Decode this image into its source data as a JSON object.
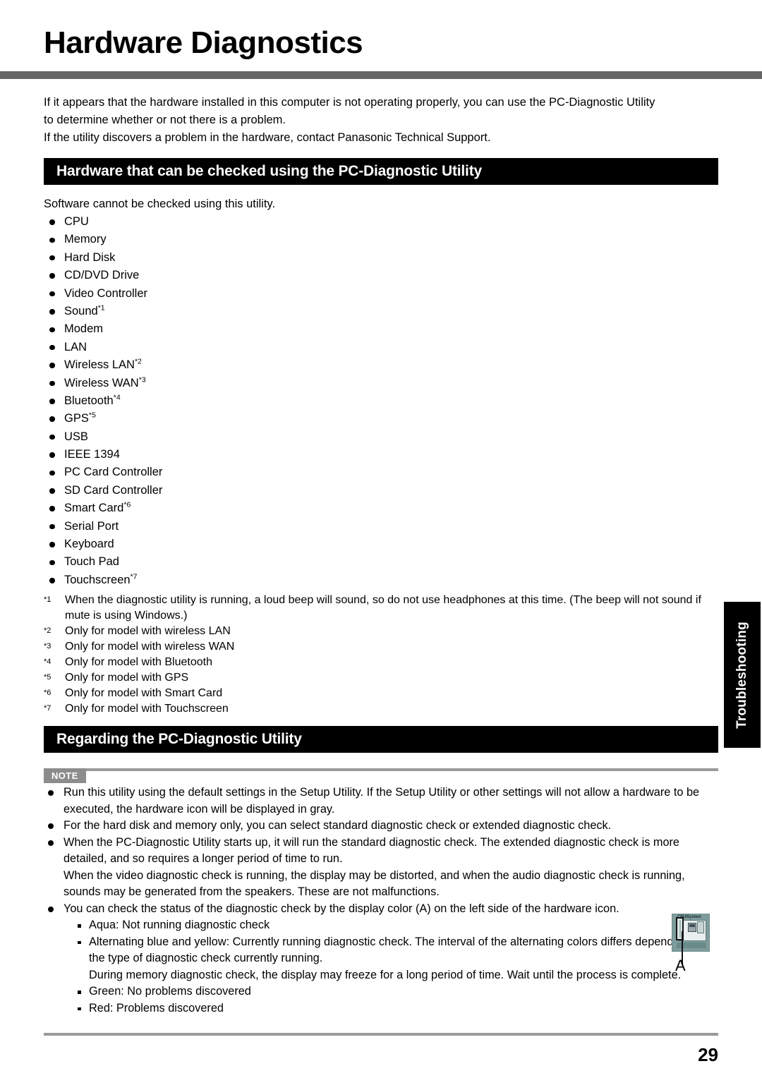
{
  "document": {
    "title": "Hardware Diagnostics",
    "page_number": "29",
    "side_tab_label": "Troubleshooting"
  },
  "intro": {
    "line1": "If it appears that the hardware installed in this computer is not operating properly, you can use the PC-Diagnostic Utility",
    "line2": "to determine whether or not there is a problem.",
    "line3": "If the utility discovers a problem in the hardware, contact Panasonic Technical Support."
  },
  "sections": {
    "hardware_checked": {
      "heading": "Hardware that can be checked using the PC-Diagnostic Utility",
      "lead": "Software cannot be checked using this utility.",
      "items": [
        {
          "label": "CPU",
          "footnote": ""
        },
        {
          "label": "Memory",
          "footnote": ""
        },
        {
          "label": "Hard Disk",
          "footnote": ""
        },
        {
          "label": "CD/DVD Drive",
          "footnote": ""
        },
        {
          "label": "Video Controller",
          "footnote": ""
        },
        {
          "label": "Sound",
          "footnote": "*1"
        },
        {
          "label": "Modem",
          "footnote": ""
        },
        {
          "label": "LAN",
          "footnote": ""
        },
        {
          "label": "Wireless LAN",
          "footnote": "*2"
        },
        {
          "label": "Wireless WAN",
          "footnote": "*3"
        },
        {
          "label": "Bluetooth",
          "footnote": "*4"
        },
        {
          "label": "GPS",
          "footnote": "*5"
        },
        {
          "label": "USB",
          "footnote": ""
        },
        {
          "label": "IEEE 1394",
          "footnote": ""
        },
        {
          "label": "PC Card Controller",
          "footnote": ""
        },
        {
          "label": "SD Card Controller",
          "footnote": ""
        },
        {
          "label": "Smart Card",
          "footnote": "*6"
        },
        {
          "label": "Serial Port",
          "footnote": ""
        },
        {
          "label": "Keyboard",
          "footnote": ""
        },
        {
          "label": "Touch Pad",
          "footnote": ""
        },
        {
          "label": "Touchscreen",
          "footnote": "*7"
        }
      ],
      "footnotes": [
        {
          "marker": "*1",
          "text": "When the diagnostic utility is running, a loud beep will sound, so do not use headphones at this time. (The beep will not sound if mute is using Windows.)"
        },
        {
          "marker": "*2",
          "text": "Only for model with wireless LAN"
        },
        {
          "marker": "*3",
          "text": "Only for model with wireless WAN"
        },
        {
          "marker": "*4",
          "text": "Only for model with Bluetooth"
        },
        {
          "marker": "*5",
          "text": "Only for model with GPS"
        },
        {
          "marker": "*6",
          "text": "Only for model with Smart Card"
        },
        {
          "marker": "*7",
          "text": "Only for model with Touchscreen"
        }
      ]
    },
    "regarding_utility": {
      "heading": "Regarding the PC-Diagnostic Utility",
      "note_badge": "NOTE",
      "note_items": {
        "b1": "Run this utility using the default settings in the Setup Utility. If the Setup Utility or other settings will not allow a hardware to be executed, the hardware icon will be displayed in gray.",
        "b2": "For the hard disk and memory only, you can select standard diagnostic check or extended diagnostic check.",
        "b3_p1": "When the PC-Diagnostic Utility starts up, it will run the standard diagnostic check. The extended diagnostic check is more detailed, and so requires a longer period of time to run.",
        "b3_p2": "When the video diagnostic check is running, the display may be distorted, and when the audio diagnostic check is running, sounds may be generated from the speakers. These are not malfunctions.",
        "b4": "You can check the status of the diagnostic check by the display color (A) on the left side of the hardware icon.",
        "b4_sub1": "Aqua: Not running diagnostic check",
        "b4_sub2": "Alternating blue and yellow: Currently running diagnostic check. The interval of the alternating colors differs depending on the type of diagnostic check currently running.",
        "b4_sub2_extra": "During memory diagnostic check, the display may freeze for a long period of time. Wait until the process is complete.",
        "b4_sub3": "Green: No problems discovered",
        "b4_sub4": "Red: Problems discovered"
      }
    }
  },
  "figure": {
    "icon_label": "CPU/System",
    "callout_letter": "A"
  },
  "colors": {
    "section_bar_bg": "#000000",
    "title_rule": "#666666",
    "note_badge_bg": "#8c8c8c",
    "rule_gray": "#9a9a9a",
    "icon_bg": "#7f9c9c"
  }
}
